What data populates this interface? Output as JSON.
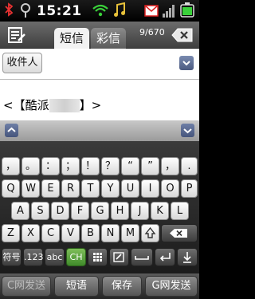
{
  "status_bar": {
    "time": "15:21"
  },
  "header": {
    "tabs": [
      {
        "label": "短信",
        "active": true
      },
      {
        "label": "彩信",
        "active": false
      }
    ],
    "counter": "9/670"
  },
  "compose": {
    "recipient_button": "收件人",
    "message_prefix": "<【酷派",
    "message_suffix": "】>"
  },
  "keyboard": {
    "row_symbols": [
      "，",
      "。",
      "：",
      "；",
      "！",
      "？",
      "“",
      "”",
      "，",
      "."
    ],
    "row1": [
      "Q",
      "W",
      "E",
      "R",
      "T",
      "Y",
      "U",
      "I",
      "O",
      "P"
    ],
    "row2": [
      "A",
      "S",
      "D",
      "F",
      "G",
      "H",
      "J",
      "K",
      "L"
    ],
    "row3": [
      "Z",
      "X",
      "C",
      "V",
      "B",
      "N",
      "M"
    ],
    "bottom_row": {
      "symbols": "符号",
      "numbers": ".123",
      "abc": "abc",
      "ch": "CH"
    }
  },
  "action_bar": {
    "c_send": "C网发送",
    "phrases": "短语",
    "save": "保存",
    "g_send": "G网发送"
  },
  "colors": {
    "accent": "#4b5a80",
    "ch_key": "#3f8a2a"
  }
}
